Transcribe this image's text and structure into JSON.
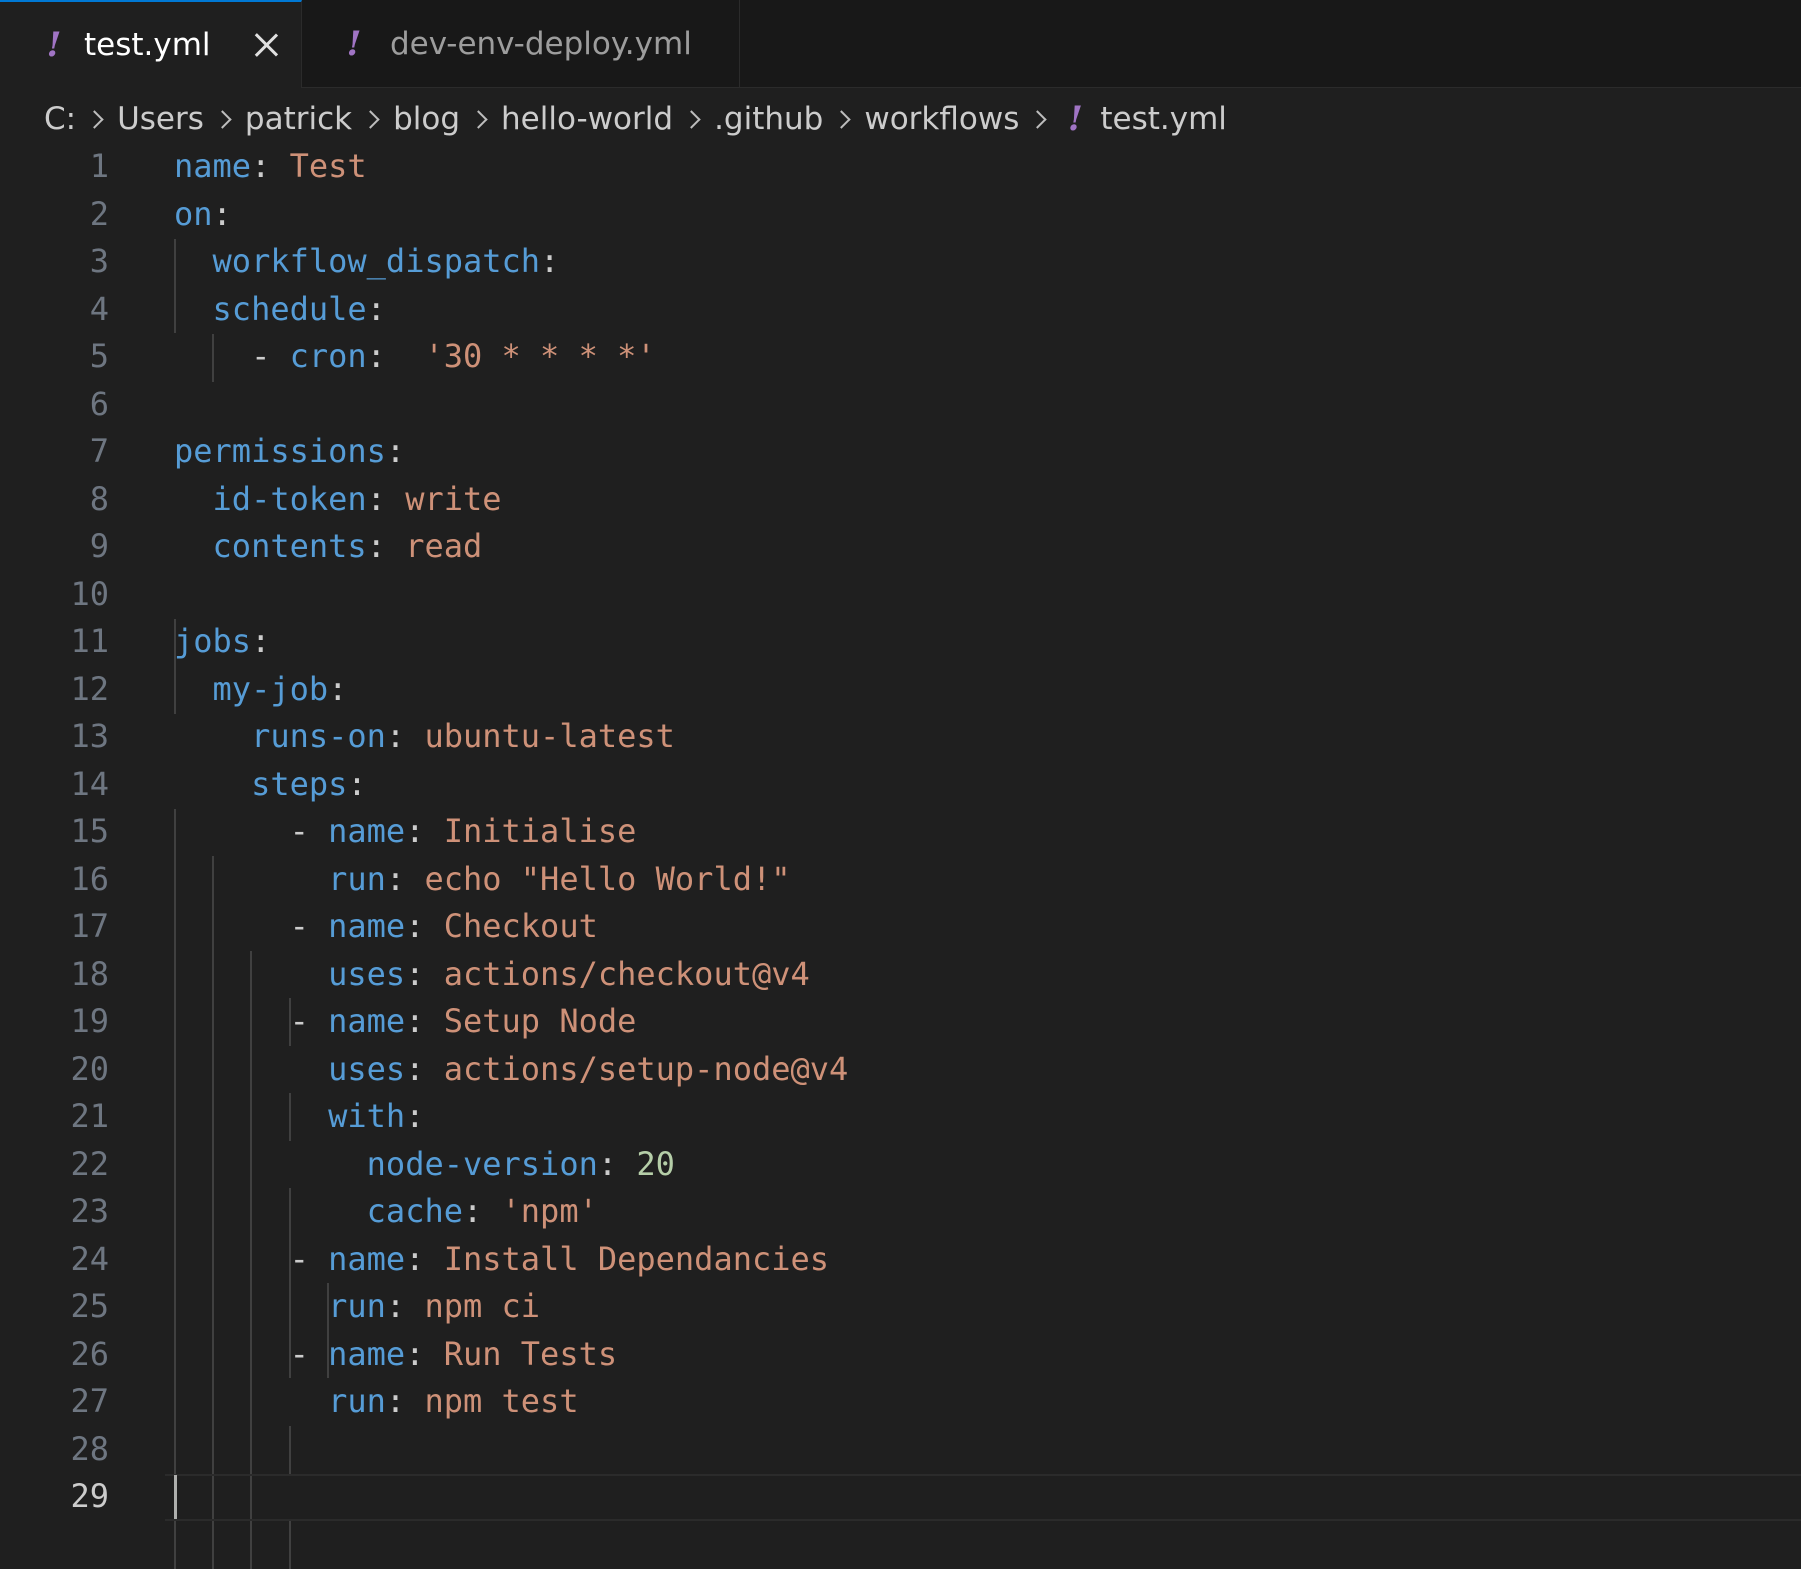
{
  "tabs": [
    {
      "label": "test.yml",
      "active": true,
      "icon": "yaml-exclamation-icon"
    },
    {
      "label": "dev-env-deploy.yml",
      "active": false,
      "icon": "yaml-exclamation-icon"
    }
  ],
  "breadcrumb": [
    "C:",
    "Users",
    "patrick",
    "blog",
    "hello-world",
    ".github",
    "workflows",
    "test.yml"
  ],
  "editor": {
    "current_line": 29,
    "lines": [
      {
        "n": "1",
        "tokens": [
          {
            "t": "name",
            "c": "k"
          },
          {
            "t": ": ",
            "c": "p"
          },
          {
            "t": "Test",
            "c": "s"
          }
        ]
      },
      {
        "n": "2",
        "tokens": [
          {
            "t": "on",
            "c": "k"
          },
          {
            "t": ":",
            "c": "p"
          }
        ]
      },
      {
        "n": "3",
        "tokens": [
          {
            "t": "  ",
            "c": "p"
          },
          {
            "t": "workflow_dispatch",
            "c": "k"
          },
          {
            "t": ":",
            "c": "p"
          }
        ]
      },
      {
        "n": "4",
        "tokens": [
          {
            "t": "  ",
            "c": "p"
          },
          {
            "t": "schedule",
            "c": "k"
          },
          {
            "t": ":",
            "c": "p"
          }
        ]
      },
      {
        "n": "5",
        "tokens": [
          {
            "t": "    - ",
            "c": "p"
          },
          {
            "t": "cron",
            "c": "k"
          },
          {
            "t": ":  ",
            "c": "p"
          },
          {
            "t": "'30 * * * *'",
            "c": "s"
          }
        ]
      },
      {
        "n": "6",
        "tokens": []
      },
      {
        "n": "7",
        "tokens": [
          {
            "t": "permissions",
            "c": "k"
          },
          {
            "t": ":",
            "c": "p"
          }
        ]
      },
      {
        "n": "8",
        "tokens": [
          {
            "t": "  ",
            "c": "p"
          },
          {
            "t": "id-token",
            "c": "k"
          },
          {
            "t": ": ",
            "c": "p"
          },
          {
            "t": "write",
            "c": "s"
          }
        ]
      },
      {
        "n": "9",
        "tokens": [
          {
            "t": "  ",
            "c": "p"
          },
          {
            "t": "contents",
            "c": "k"
          },
          {
            "t": ": ",
            "c": "p"
          },
          {
            "t": "read",
            "c": "s"
          }
        ]
      },
      {
        "n": "10",
        "tokens": []
      },
      {
        "n": "11",
        "tokens": [
          {
            "t": "jobs",
            "c": "k"
          },
          {
            "t": ":",
            "c": "p"
          }
        ]
      },
      {
        "n": "12",
        "tokens": [
          {
            "t": "  ",
            "c": "p"
          },
          {
            "t": "my-job",
            "c": "k"
          },
          {
            "t": ":",
            "c": "p"
          }
        ]
      },
      {
        "n": "13",
        "tokens": [
          {
            "t": "    ",
            "c": "p"
          },
          {
            "t": "runs-on",
            "c": "k"
          },
          {
            "t": ": ",
            "c": "p"
          },
          {
            "t": "ubuntu-latest",
            "c": "s"
          }
        ]
      },
      {
        "n": "14",
        "tokens": [
          {
            "t": "    ",
            "c": "p"
          },
          {
            "t": "steps",
            "c": "k"
          },
          {
            "t": ":",
            "c": "p"
          }
        ]
      },
      {
        "n": "15",
        "tokens": [
          {
            "t": "      - ",
            "c": "p"
          },
          {
            "t": "name",
            "c": "k"
          },
          {
            "t": ": ",
            "c": "p"
          },
          {
            "t": "Initialise",
            "c": "s"
          }
        ]
      },
      {
        "n": "16",
        "tokens": [
          {
            "t": "        ",
            "c": "p"
          },
          {
            "t": "run",
            "c": "k"
          },
          {
            "t": ": ",
            "c": "p"
          },
          {
            "t": "echo \"Hello World!\"",
            "c": "s"
          }
        ]
      },
      {
        "n": "17",
        "tokens": [
          {
            "t": "      - ",
            "c": "p"
          },
          {
            "t": "name",
            "c": "k"
          },
          {
            "t": ": ",
            "c": "p"
          },
          {
            "t": "Checkout",
            "c": "s"
          }
        ]
      },
      {
        "n": "18",
        "tokens": [
          {
            "t": "        ",
            "c": "p"
          },
          {
            "t": "uses",
            "c": "k"
          },
          {
            "t": ": ",
            "c": "p"
          },
          {
            "t": "actions/checkout@v4",
            "c": "s"
          }
        ]
      },
      {
        "n": "19",
        "tokens": [
          {
            "t": "      - ",
            "c": "p"
          },
          {
            "t": "name",
            "c": "k"
          },
          {
            "t": ": ",
            "c": "p"
          },
          {
            "t": "Setup Node",
            "c": "s"
          }
        ]
      },
      {
        "n": "20",
        "tokens": [
          {
            "t": "        ",
            "c": "p"
          },
          {
            "t": "uses",
            "c": "k"
          },
          {
            "t": ": ",
            "c": "p"
          },
          {
            "t": "actions/setup-node@v4",
            "c": "s"
          }
        ]
      },
      {
        "n": "21",
        "tokens": [
          {
            "t": "        ",
            "c": "p"
          },
          {
            "t": "with",
            "c": "k"
          },
          {
            "t": ":",
            "c": "p"
          }
        ]
      },
      {
        "n": "22",
        "tokens": [
          {
            "t": "          ",
            "c": "p"
          },
          {
            "t": "node-version",
            "c": "k"
          },
          {
            "t": ": ",
            "c": "p"
          },
          {
            "t": "20",
            "c": "n"
          }
        ]
      },
      {
        "n": "23",
        "tokens": [
          {
            "t": "          ",
            "c": "p"
          },
          {
            "t": "cache",
            "c": "k"
          },
          {
            "t": ": ",
            "c": "p"
          },
          {
            "t": "'npm'",
            "c": "s"
          }
        ]
      },
      {
        "n": "24",
        "tokens": [
          {
            "t": "      - ",
            "c": "p"
          },
          {
            "t": "name",
            "c": "k"
          },
          {
            "t": ": ",
            "c": "p"
          },
          {
            "t": "Install Dependancies",
            "c": "s"
          }
        ]
      },
      {
        "n": "25",
        "tokens": [
          {
            "t": "        ",
            "c": "p"
          },
          {
            "t": "run",
            "c": "k"
          },
          {
            "t": ": ",
            "c": "p"
          },
          {
            "t": "npm ci",
            "c": "s"
          }
        ]
      },
      {
        "n": "26",
        "tokens": [
          {
            "t": "      - ",
            "c": "p"
          },
          {
            "t": "name",
            "c": "k"
          },
          {
            "t": ": ",
            "c": "p"
          },
          {
            "t": "Run Tests",
            "c": "s"
          }
        ]
      },
      {
        "n": "27",
        "tokens": [
          {
            "t": "        ",
            "c": "p"
          },
          {
            "t": "run",
            "c": "k"
          },
          {
            "t": ": ",
            "c": "p"
          },
          {
            "t": "npm test",
            "c": "s"
          }
        ]
      },
      {
        "n": "28",
        "tokens": []
      },
      {
        "n": "29",
        "tokens": []
      }
    ]
  }
}
